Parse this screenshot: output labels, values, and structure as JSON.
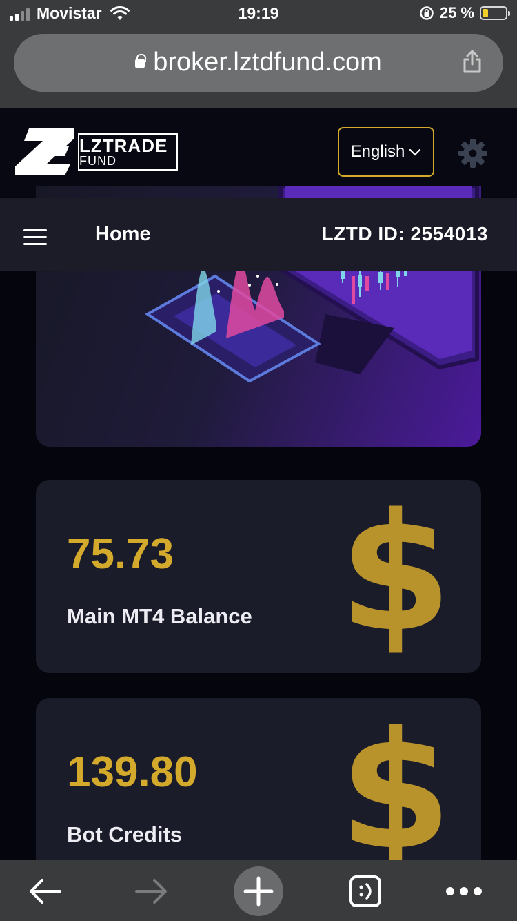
{
  "status_bar": {
    "carrier": "Movistar",
    "time": "19:19",
    "battery_percent": "25 %",
    "battery_level": 0.25
  },
  "browser": {
    "url": "broker.lztdfund.com"
  },
  "header": {
    "logo_text": "LZTRADE",
    "logo_subtext": "FUND",
    "language": "English"
  },
  "nav": {
    "title": "Home",
    "lztd_id": "LZTD ID: 2554013"
  },
  "cards": [
    {
      "value": "75.73",
      "label": "Main MT4 Balance",
      "icon": "dollar-icon",
      "symbol": "$"
    },
    {
      "value": "139.80",
      "label": "Bot Credits",
      "icon": "dollar-icon",
      "symbol": "$"
    }
  ],
  "colors": {
    "accent": "#d4aa2c",
    "card_bg": "#1b1c2a",
    "page_bg": "#05060d",
    "nav_bg": "#1b1c28"
  }
}
